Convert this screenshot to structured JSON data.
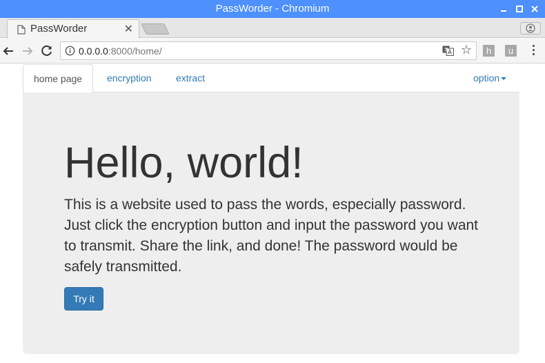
{
  "window": {
    "title": "PassWorder - Chromium"
  },
  "tabs": [
    {
      "title": "PassWorder"
    }
  ],
  "address_bar": {
    "host": "0.0.0.0",
    "path": ":8000/home/"
  },
  "extensions": {
    "ext1": "h",
    "ext2": "u"
  },
  "nav": {
    "items": [
      "home page",
      "encryption",
      "extract"
    ],
    "option_label": "option"
  },
  "hero": {
    "heading": "Hello, world!",
    "text": "This is a website used to pass the words, especially password. Just click the encryption button and input the password you want to transmit. Share the link, and done! The password would be safely transmitted.",
    "button_label": "Try it"
  },
  "colors": {
    "titlebar": "#4d90fe",
    "primary": "#337ab7",
    "jumbotron": "#eeeeee"
  }
}
